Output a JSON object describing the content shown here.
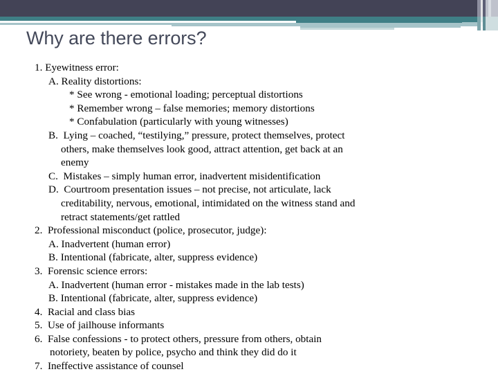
{
  "slide": {
    "title": "Why are there errors?",
    "theme": {
      "navy_band": "#434356",
      "teal_band": "#3f7f86",
      "light_blue_band": "#a6c4c9",
      "pale_accent": "#c4d8da",
      "title_color": "#44495a",
      "body_color": "#000000",
      "background": "#ffffff"
    }
  },
  "outline": [
    {
      "level": 1,
      "text": "1. Eyewitness error:"
    },
    {
      "level": 2,
      "text": "A. Reality distortions:"
    },
    {
      "level": 3,
      "text": "* See wrong - emotional loading; perceptual distortions"
    },
    {
      "level": 3,
      "text": "* Remember wrong – false memories; memory distortions"
    },
    {
      "level": 3,
      "text": "* Confabulation (particularly with young witnesses)"
    },
    {
      "level": 2,
      "text": "B.  Lying – coached, “testilying,” pressure, protect themselves, protect"
    },
    {
      "level": "2w",
      "text": "others, make themselves look good, attract attention, get back at an"
    },
    {
      "level": "2w",
      "text": "enemy"
    },
    {
      "level": 2,
      "text": "C.  Mistakes – simply human error, inadvertent misidentification"
    },
    {
      "level": 2,
      "text": "D.  Courtroom presentation issues – not precise, not articulate, lack"
    },
    {
      "level": "2w",
      "text": "creditability, nervous, emotional, intimidated on the witness stand and"
    },
    {
      "level": "2w",
      "text": "retract statements/get rattled"
    },
    {
      "level": 1,
      "text": "2.  Professional misconduct (police, prosecutor, judge):"
    },
    {
      "level": 2,
      "text": "A. Inadvertent (human error)"
    },
    {
      "level": 2,
      "text": "B. Intentional (fabricate, alter, suppress evidence)"
    },
    {
      "level": 1,
      "text": "3.  Forensic science errors:"
    },
    {
      "level": 2,
      "text": "A. Inadvertent (human error - mistakes made in the lab tests)"
    },
    {
      "level": 2,
      "text": "B. Intentional (fabricate, alter, suppress evidence)"
    },
    {
      "level": 1,
      "text": "4.  Racial and class bias"
    },
    {
      "level": 1,
      "text": "5.  Use of jailhouse informants"
    },
    {
      "level": 1,
      "text": "6.  False confessions - to protect others, pressure from others, obtain"
    },
    {
      "level": "1w",
      "text": "notoriety, beaten by police, psycho and think they did do it"
    },
    {
      "level": 1,
      "text": "7.  Ineffective assistance of counsel"
    }
  ]
}
